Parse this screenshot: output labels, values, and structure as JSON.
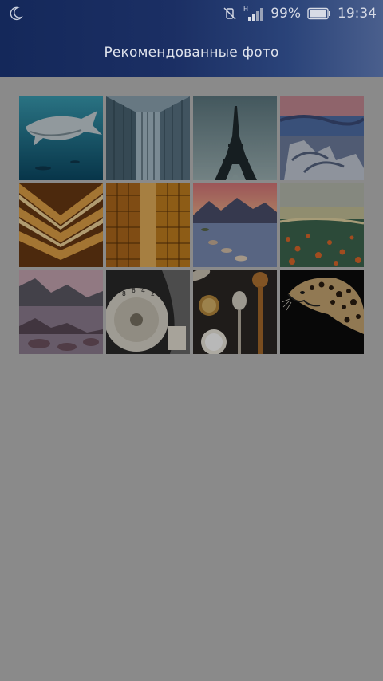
{
  "status_bar": {
    "battery_percent": "99%",
    "time": "19:34",
    "network_type": "H",
    "icons": [
      "moon-icon",
      "vibrate-icon",
      "signal-icon",
      "battery-icon"
    ]
  },
  "header": {
    "title": "Рекомендованные фото"
  },
  "colors": {
    "header_dark": "#14285a",
    "header_light": "#4a5f8d",
    "overlay_background": "#8a8a8a"
  },
  "photos": [
    {
      "subject": "shark"
    },
    {
      "subject": "glass-building"
    },
    {
      "subject": "eiffel-tower"
    },
    {
      "subject": "driftwood-coast"
    },
    {
      "subject": "wooden-ceiling"
    },
    {
      "subject": "reflected-towers"
    },
    {
      "subject": "mountain-lake-sunset"
    },
    {
      "subject": "flower-field"
    },
    {
      "subject": "mountain-lake"
    },
    {
      "subject": "camera-dial"
    },
    {
      "subject": "spices-spoons"
    },
    {
      "subject": "leopard"
    }
  ]
}
